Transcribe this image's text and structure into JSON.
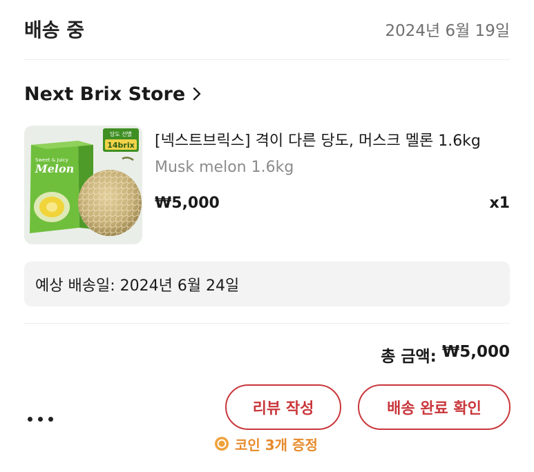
{
  "order": {
    "status": "배송 중",
    "date": "2024년 6월 19일"
  },
  "store": {
    "name": "Next Brix Store",
    "chevron_icon": "chevron-right-icon"
  },
  "product": {
    "title": "[넥스트브릭스] 격이 다른 당도, 머스크 멜론 1.6kg",
    "option": "Musk melon 1.6kg",
    "price": "₩5,000",
    "quantity": "x1",
    "image": {
      "badge_top": "당도 선별",
      "badge_bottom": "14brix",
      "box_small": "Sweet & Juicy",
      "box_brand": "Melon"
    }
  },
  "delivery": {
    "eta": "예상 배송일: 2024년 6월 24일"
  },
  "summary": {
    "total_label": "총 금액:",
    "total_value": "₩5,000"
  },
  "actions": {
    "more_icon": "more-horizontal-icon",
    "review_label": "리뷰 작성",
    "confirm_label": "배송 완료 확인",
    "reward_text": "코인 3개 증정",
    "reward_icon": "coin-icon"
  },
  "colors": {
    "accent": "#c9363b",
    "reward": "#e78a2c",
    "muted_text": "#8b8b8b",
    "eta_bg": "#f3f3f3"
  }
}
